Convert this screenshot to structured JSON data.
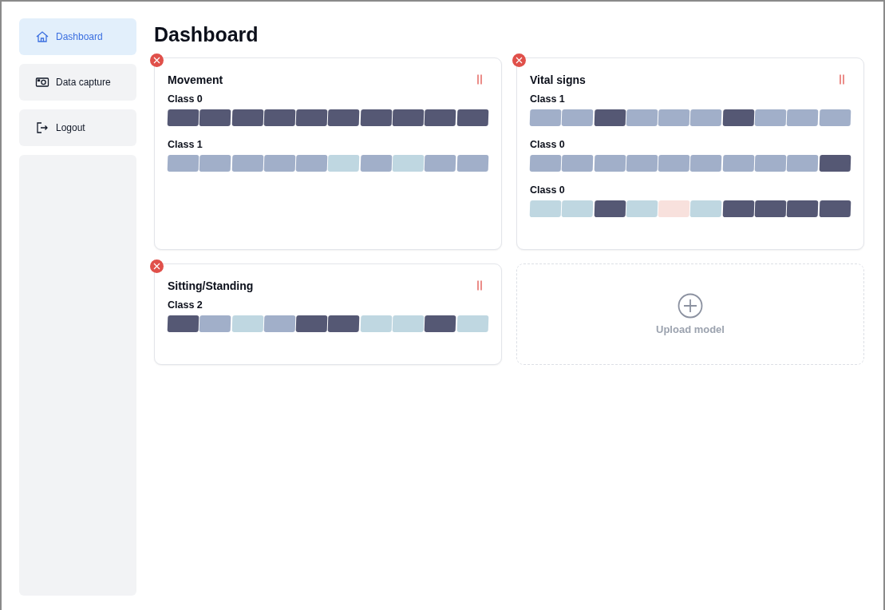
{
  "sidebar": {
    "items": [
      {
        "label": "Dashboard",
        "selected": true
      },
      {
        "label": "Data capture",
        "selected": false
      },
      {
        "label": "Logout",
        "selected": false
      }
    ]
  },
  "page_title": "Dashboard",
  "models": [
    {
      "title": "Movement",
      "rows": [
        {
          "label": "Class 0",
          "segments": [
            {
              "color": "#555874"
            },
            {
              "color": "#555874"
            },
            {
              "color": "#555874"
            },
            {
              "color": "#555874"
            },
            {
              "color": "#555874"
            },
            {
              "color": "#555874"
            },
            {
              "color": "#555874"
            },
            {
              "color": "#555874"
            },
            {
              "color": "#555874"
            },
            {
              "color": "#555874"
            }
          ]
        },
        {
          "label": "Class 1",
          "segments": [
            {
              "color": "#a1afc9"
            },
            {
              "color": "#a1afc9"
            },
            {
              "color": "#a1afc9"
            },
            {
              "color": "#a1afc9"
            },
            {
              "color": "#a1afc9"
            },
            {
              "color": "#bfd7e1"
            },
            {
              "color": "#a1afc9"
            },
            {
              "color": "#bfd7e1"
            },
            {
              "color": "#a1afc9"
            },
            {
              "color": "#a1afc9"
            }
          ]
        }
      ]
    },
    {
      "title": "Vital signs",
      "rows": [
        {
          "label": "Class 1",
          "segments": [
            {
              "color": "#a1afc9"
            },
            {
              "color": "#a1afc9"
            },
            {
              "color": "#555874"
            },
            {
              "color": "#a1afc9"
            },
            {
              "color": "#a1afc9"
            },
            {
              "color": "#a1afc9"
            },
            {
              "color": "#555874"
            },
            {
              "color": "#a1afc9"
            },
            {
              "color": "#a1afc9"
            },
            {
              "color": "#a1afc9"
            }
          ]
        },
        {
          "label": "Class 0",
          "segments": [
            {
              "color": "#a1afc9"
            },
            {
              "color": "#a1afc9"
            },
            {
              "color": "#a1afc9"
            },
            {
              "color": "#a1afc9"
            },
            {
              "color": "#a1afc9"
            },
            {
              "color": "#a1afc9"
            },
            {
              "color": "#a1afc9"
            },
            {
              "color": "#a1afc9"
            },
            {
              "color": "#a1afc9"
            },
            {
              "color": "#555874"
            }
          ]
        },
        {
          "label": "Class 0",
          "segments": [
            {
              "color": "#bfd7e1"
            },
            {
              "color": "#bfd7e1"
            },
            {
              "color": "#555874"
            },
            {
              "color": "#bfd7e1"
            },
            {
              "color": "#f8e1dd"
            },
            {
              "color": "#bfd7e1"
            },
            {
              "color": "#555874"
            },
            {
              "color": "#555874"
            },
            {
              "color": "#555874"
            },
            {
              "color": "#555874"
            }
          ]
        }
      ]
    },
    {
      "title": "Sitting/Standing",
      "rows": [
        {
          "label": "Class 2",
          "segments": [
            {
              "color": "#555874"
            },
            {
              "color": "#a1afc9"
            },
            {
              "color": "#bfd7e1"
            },
            {
              "color": "#a1afc9"
            },
            {
              "color": "#555874"
            },
            {
              "color": "#555874"
            },
            {
              "color": "#bfd7e1"
            },
            {
              "color": "#bfd7e1"
            },
            {
              "color": "#555874"
            },
            {
              "color": "#bfd7e1"
            }
          ]
        }
      ]
    }
  ],
  "upload": {
    "label": "Upload model"
  }
}
